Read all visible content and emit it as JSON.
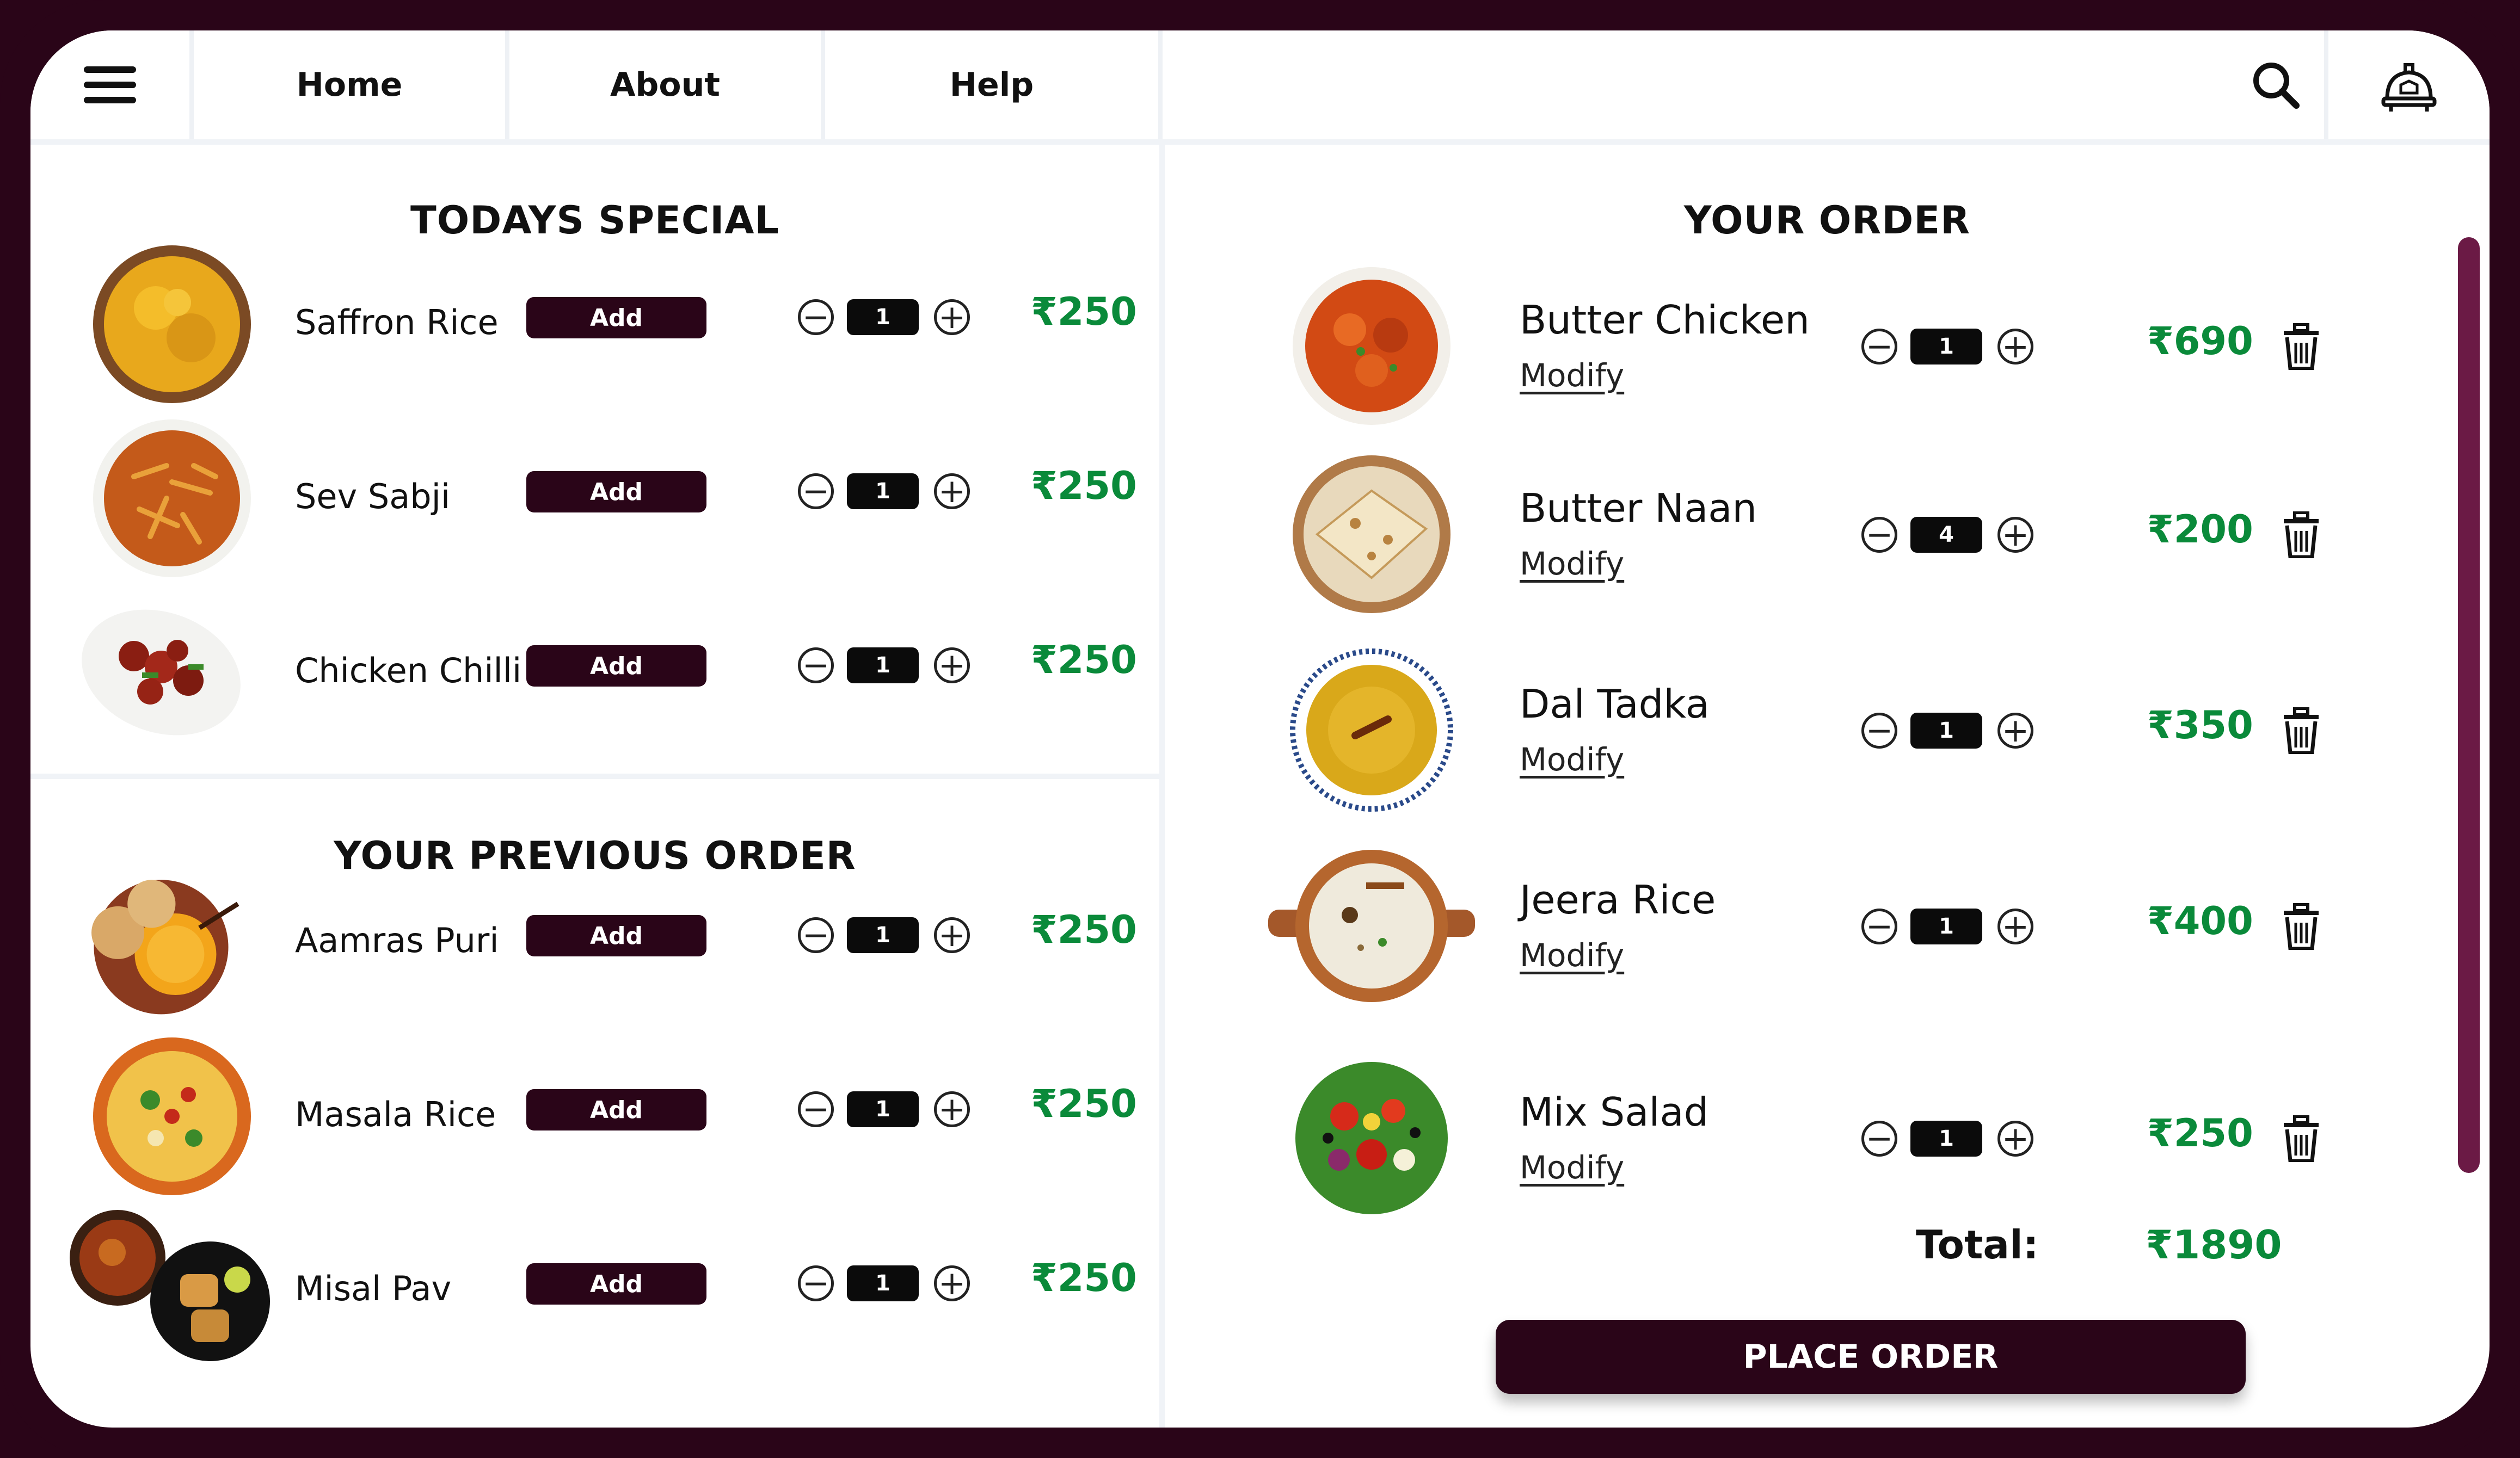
{
  "nav": {
    "items": [
      "Home",
      "About",
      "Help"
    ],
    "icons": {
      "menu": "hamburger-icon",
      "search": "search-icon",
      "bell": "service-bell-icon"
    }
  },
  "todays_special": {
    "title": "TODAYS SPECIAL",
    "items": [
      {
        "name": "Saffron Rice",
        "add_label": "Add",
        "qty": "1",
        "price": "₹250",
        "image": "saffron-rice-image"
      },
      {
        "name": "Sev Sabji",
        "add_label": "Add",
        "qty": "1",
        "price": "₹250",
        "image": "sev-sabji-image"
      },
      {
        "name": "Chicken Chilli",
        "add_label": "Add",
        "qty": "1",
        "price": "₹250",
        "image": "chicken-chilli-image"
      }
    ]
  },
  "previous_order": {
    "title": "YOUR PREVIOUS ORDER",
    "items": [
      {
        "name": "Aamras Puri",
        "add_label": "Add",
        "qty": "1",
        "price": "₹250",
        "image": "aamras-puri-image"
      },
      {
        "name": "Masala Rice",
        "add_label": "Add",
        "qty": "1",
        "price": "₹250",
        "image": "masala-rice-image"
      },
      {
        "name": "Misal Pav",
        "add_label": "Add",
        "qty": "1",
        "price": "₹250",
        "image": "misal-pav-image"
      }
    ]
  },
  "your_order": {
    "title": "YOUR ORDER",
    "items": [
      {
        "name": "Butter Chicken",
        "modify": "Modify",
        "qty": "1",
        "price": "₹690",
        "image": "butter-chicken-image"
      },
      {
        "name": "Butter Naan",
        "modify": "Modify",
        "qty": "4",
        "price": "₹200",
        "image": "butter-naan-image"
      },
      {
        "name": "Dal Tadka",
        "modify": "Modify",
        "qty": "1",
        "price": "₹350",
        "image": "dal-tadka-image"
      },
      {
        "name": "Jeera Rice",
        "modify": "Modify",
        "qty": "1",
        "price": "₹400",
        "image": "jeera-rice-image"
      },
      {
        "name": "Mix Salad",
        "modify": "Modify",
        "qty": "1",
        "price": "₹250",
        "image": "mix-salad-image"
      }
    ],
    "total_label": "Total:",
    "total_value": "₹1890",
    "place_order": "PLACE ORDER"
  },
  "colors": {
    "brand": "#2a0518",
    "price": "#0a8a3a",
    "scrollbar": "#6b1a45"
  }
}
